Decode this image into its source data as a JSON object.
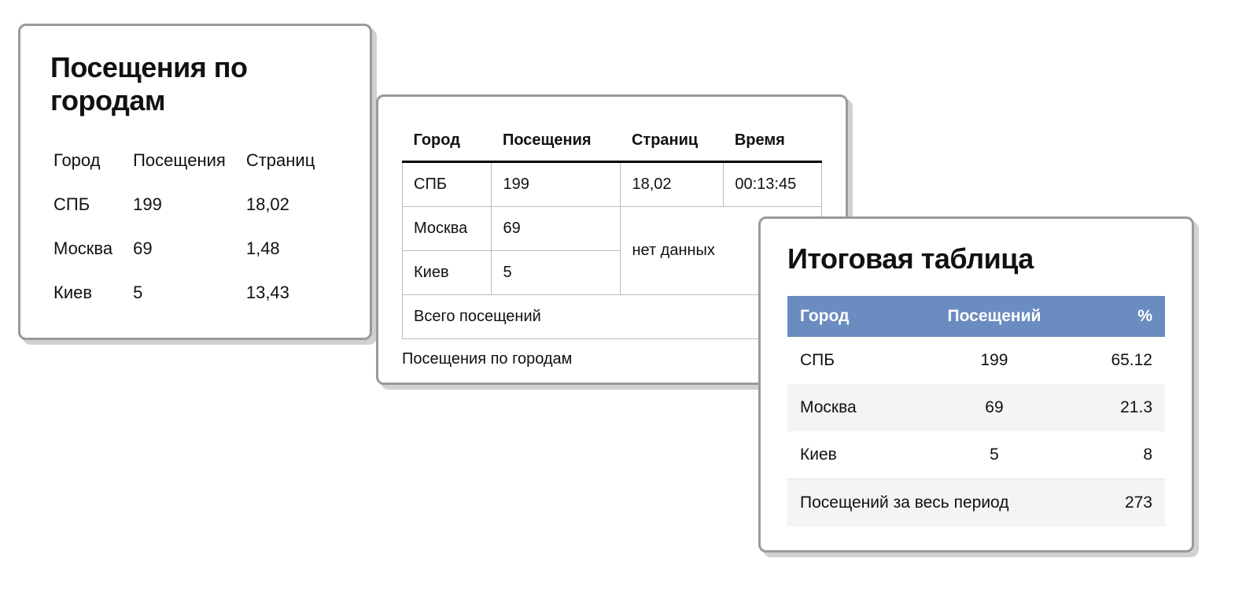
{
  "card1": {
    "title": "Посещения по городам",
    "headers": {
      "city": "Город",
      "visits": "Посещения",
      "pages": "Страниц"
    },
    "rows": [
      {
        "city": "СПБ",
        "visits": "199",
        "pages": "18,02"
      },
      {
        "city": "Москва",
        "visits": "69",
        "pages": "1,48"
      },
      {
        "city": "Киев",
        "visits": "5",
        "pages": "13,43"
      }
    ]
  },
  "card2": {
    "headers": {
      "city": "Город",
      "visits": "Посещения",
      "pages": "Страниц",
      "time": "Время"
    },
    "row0": {
      "city": "СПБ",
      "visits": "199",
      "pages": "18,02",
      "time": "00:13:45"
    },
    "row1": {
      "city": "Москва",
      "visits": "69"
    },
    "row2": {
      "city": "Киев",
      "visits": "5"
    },
    "no_data": "нет данных",
    "total_label": "Всего посещений",
    "caption": "Посещения по городам"
  },
  "card3": {
    "title": "Итоговая таблица",
    "headers": {
      "city": "Город",
      "visits": "Посещений",
      "pct": "%"
    },
    "rows": [
      {
        "city": "СПБ",
        "visits": "199",
        "pct": "65.12"
      },
      {
        "city": "Москва",
        "visits": "69",
        "pct": "21.3"
      },
      {
        "city": "Киев",
        "visits": "5",
        "pct": "8"
      }
    ],
    "footer_label": "Посещений за весь период",
    "footer_value": "273"
  },
  "chart_data": [
    {
      "type": "table",
      "title": "Посещения по городам",
      "columns": [
        "Город",
        "Посещения",
        "Страниц"
      ],
      "rows": [
        [
          "СПБ",
          199,
          18.02
        ],
        [
          "Москва",
          69,
          1.48
        ],
        [
          "Киев",
          5,
          13.43
        ]
      ]
    },
    {
      "type": "table",
      "title": "Посещения по городам",
      "columns": [
        "Город",
        "Посещения",
        "Страниц",
        "Время"
      ],
      "rows": [
        [
          "СПБ",
          199,
          18.02,
          "00:13:45"
        ],
        [
          "Москва",
          69,
          null,
          null
        ],
        [
          "Киев",
          5,
          null,
          null
        ]
      ],
      "annotations": [
        "нет данных",
        "Всего посещений"
      ]
    },
    {
      "type": "table",
      "title": "Итоговая таблица",
      "columns": [
        "Город",
        "Посещений",
        "%"
      ],
      "rows": [
        [
          "СПБ",
          199,
          65.12
        ],
        [
          "Москва",
          69,
          21.3
        ],
        [
          "Киев",
          5,
          8
        ]
      ],
      "footer": [
        "Посещений за весь период",
        273
      ]
    }
  ]
}
